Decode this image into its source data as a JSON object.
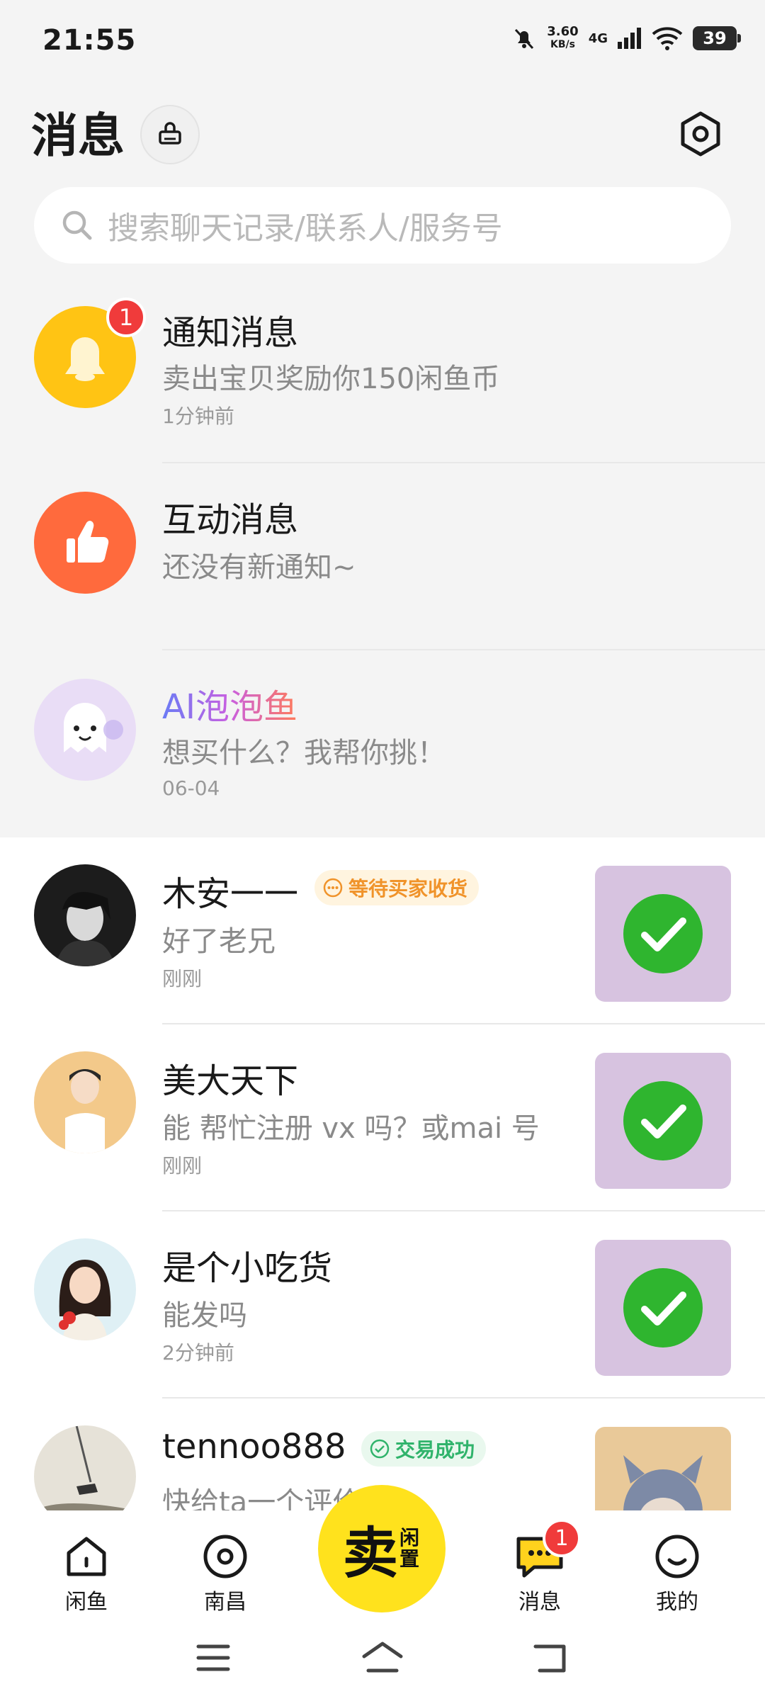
{
  "status": {
    "time": "21:55",
    "net_speed_value": "3.60",
    "net_speed_unit": "KB/s",
    "network": "4G",
    "battery": "39"
  },
  "header": {
    "title": "消息"
  },
  "search": {
    "placeholder": "搜索聊天记录/联系人/服务号"
  },
  "system_rows": [
    {
      "title": "通知消息",
      "message": "卖出宝贝奖励你150闲鱼币",
      "time": "1分钟前",
      "badge": "1"
    },
    {
      "title": "互动消息",
      "message": "还没有新通知~",
      "time": ""
    },
    {
      "title": "AI泡泡鱼",
      "message": "想买什么？我帮你挑！",
      "time": "06-04"
    }
  ],
  "chats": [
    {
      "name": "木安一一",
      "tag": "等待买家收货",
      "message": "好了老兄",
      "time": "刚刚"
    },
    {
      "name": "美大天下",
      "tag": "",
      "message": "能 帮忙注册 vx 吗？或mai 号",
      "time": "刚刚"
    },
    {
      "name": "是个小吃货",
      "tag": "",
      "message": "能发吗",
      "time": "2分钟前"
    },
    {
      "name": "tennoo888",
      "tag": "交易成功",
      "message": "快给ta一个评价",
      "time": ""
    }
  ],
  "bottom_nav": {
    "home": "闲鱼",
    "city": "南昌",
    "sell_main": "卖",
    "sell_sub": "闲置",
    "messages": "消息",
    "messages_badge": "1",
    "mine": "我的"
  },
  "colors": {
    "brand_yellow": "#ffe21d",
    "badge_red": "#f03b3b",
    "tag_orange": "#f0932a",
    "tag_green": "#30b36b"
  }
}
